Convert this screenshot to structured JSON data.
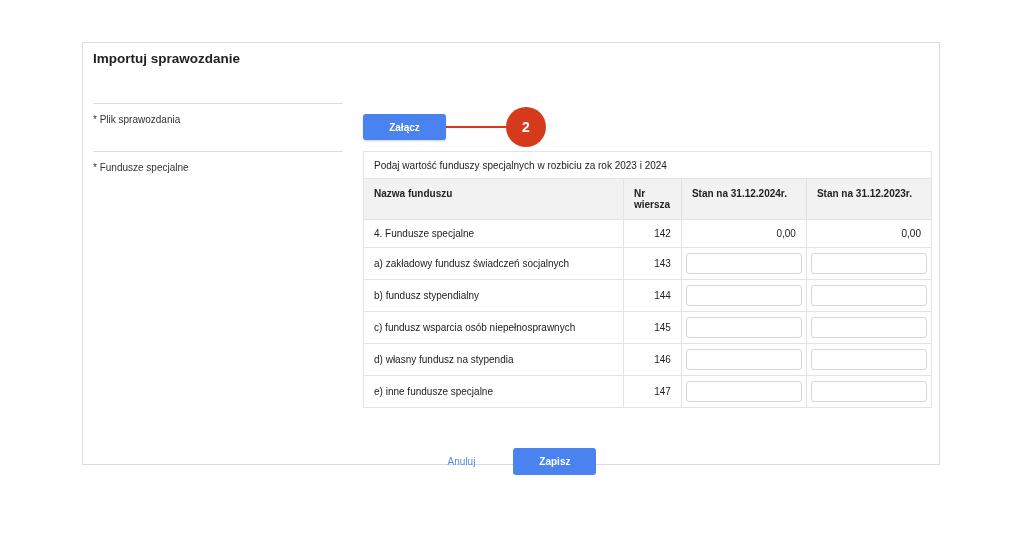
{
  "dialog": {
    "title": "Importuj sprawozdanie"
  },
  "file_field": {
    "label": "* Plik sprawozdania",
    "button": "Załącz",
    "callout": "2"
  },
  "funds_field": {
    "label": "* Fundusze specjalne",
    "caption": "Podaj wartość funduszy specjalnych w rozbiciu za rok 2023 i 2024",
    "columns": [
      "Nazwa funduszu",
      "Nr wiersza",
      "Stan na 31.12.2024r.",
      "Stan na 31.12.2023r."
    ],
    "rows": [
      {
        "kind": "total",
        "name": "4. Fundusze specjalne",
        "nr": "142",
        "values": [
          "0,00",
          "0,00"
        ]
      },
      {
        "kind": "input",
        "name": "a) zakładowy fundusz świadczeń socjalnych",
        "nr": "143"
      },
      {
        "kind": "input",
        "name": "b) fundusz stypendialny",
        "nr": "144"
      },
      {
        "kind": "input",
        "name": "c) fundusz wsparcia osób niepełnosprawnych",
        "nr": "145"
      },
      {
        "kind": "input",
        "name": "d) własny fundusz na stypendia",
        "nr": "146"
      },
      {
        "kind": "input",
        "name": "e) inne fundusze specjalne",
        "nr": "147"
      }
    ]
  },
  "actions": {
    "cancel": "Anuluj",
    "save": "Zapisz"
  }
}
